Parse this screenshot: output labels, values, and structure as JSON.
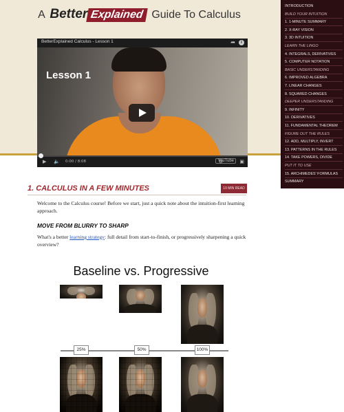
{
  "header": {
    "title_prefix": "A",
    "brand_part1": "Better",
    "brand_part2": "Explained",
    "title_suffix": "Guide To Calculus"
  },
  "video": {
    "title": "BetterExplained Calculus - Lesson 1",
    "overlay_text": "Lesson 1",
    "time": "0:00 / 8:08",
    "progress": 0,
    "source_label": "YouTube"
  },
  "sidebar": {
    "entries": [
      {
        "kind": "intro",
        "label": "INTRODUCTION"
      },
      {
        "kind": "section",
        "label": "BUILD YOUR INTUITION"
      },
      {
        "kind": "item",
        "label": "1. 1-MINUTE SUMMARY"
      },
      {
        "kind": "item",
        "label": "2. X-RAY VISION"
      },
      {
        "kind": "item",
        "label": "3. 3D INTUITION"
      },
      {
        "kind": "section",
        "label": "LEARN THE LINGO"
      },
      {
        "kind": "item",
        "label": "4. INTEGRALS, DERIVATIVES"
      },
      {
        "kind": "item",
        "label": "5. COMPUTER NOTATION"
      },
      {
        "kind": "section",
        "label": "BASIC UNDERSTANDING"
      },
      {
        "kind": "item",
        "label": "6. IMPROVED ALGEBRA"
      },
      {
        "kind": "item",
        "label": "7. LINEAR CHANGES"
      },
      {
        "kind": "item",
        "label": "8. SQUARED CHANGES"
      },
      {
        "kind": "section",
        "label": "DEEPER UNDERSTANDING"
      },
      {
        "kind": "item",
        "label": "9. INFINITY"
      },
      {
        "kind": "item",
        "label": "10. DERIVATIVES"
      },
      {
        "kind": "item",
        "label": "11. FUNDAMENTAL THEOREM"
      },
      {
        "kind": "section",
        "label": "FIGURE OUT THE RULES"
      },
      {
        "kind": "item",
        "label": "12. ADD, MULTIPLY, INVERT"
      },
      {
        "kind": "item",
        "label": "13. PATTERNS IN THE RULES"
      },
      {
        "kind": "item",
        "label": "14. TAKE POWERS, DIVIDE"
      },
      {
        "kind": "section",
        "label": "PUT IT TO USE"
      },
      {
        "kind": "item",
        "label": "15. ARCHIMEDES' FORMULAS"
      },
      {
        "kind": "intro",
        "label": "SUMMARY"
      }
    ]
  },
  "main": {
    "section_title": "1. CALCULUS IN A FEW MINUTES",
    "read_badge": "10 MIN READ",
    "intro": "Welcome to the Calculus course! Before we start, just a quick note about the intuition-first learning approach.",
    "subheading": "MOVE FROM BLURRY TO SHARP",
    "question_before": "What's a better ",
    "question_link": "learning strategy",
    "question_after": ": full detail from start-to-finish, or progressively sharpening a quick overview?"
  },
  "figure": {
    "title": "Baseline vs. Progressive",
    "labels": [
      "25%",
      "50%",
      "100%"
    ]
  }
}
